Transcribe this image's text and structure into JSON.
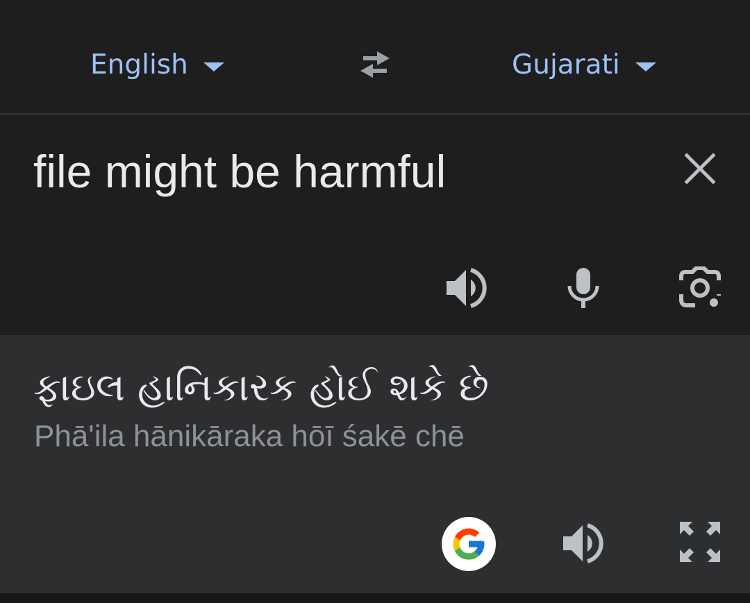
{
  "languages": {
    "source": "English",
    "target": "Gujarati"
  },
  "input": {
    "text": "file might be harmful"
  },
  "output": {
    "text": "ફાઇલ હાનિકારક હોઈ શકે છે",
    "transliteration": "Phā'ila hānikāraka hōī śakē chē"
  },
  "icons": {
    "swap": "swap-arrows-icon",
    "clear": "close-icon",
    "speak_source": "speaker-icon",
    "mic": "microphone-icon",
    "camera": "camera-icon",
    "google": "google-icon",
    "speak_target": "speaker-icon",
    "fullscreen": "fullscreen-icon"
  },
  "colors": {
    "accent": "#9dc1f5",
    "background": "#1e1e1f",
    "output_background": "#2d2e30",
    "text": "#e8eaed",
    "secondary_text": "#8e9195",
    "icon": "#bdc1c6"
  }
}
